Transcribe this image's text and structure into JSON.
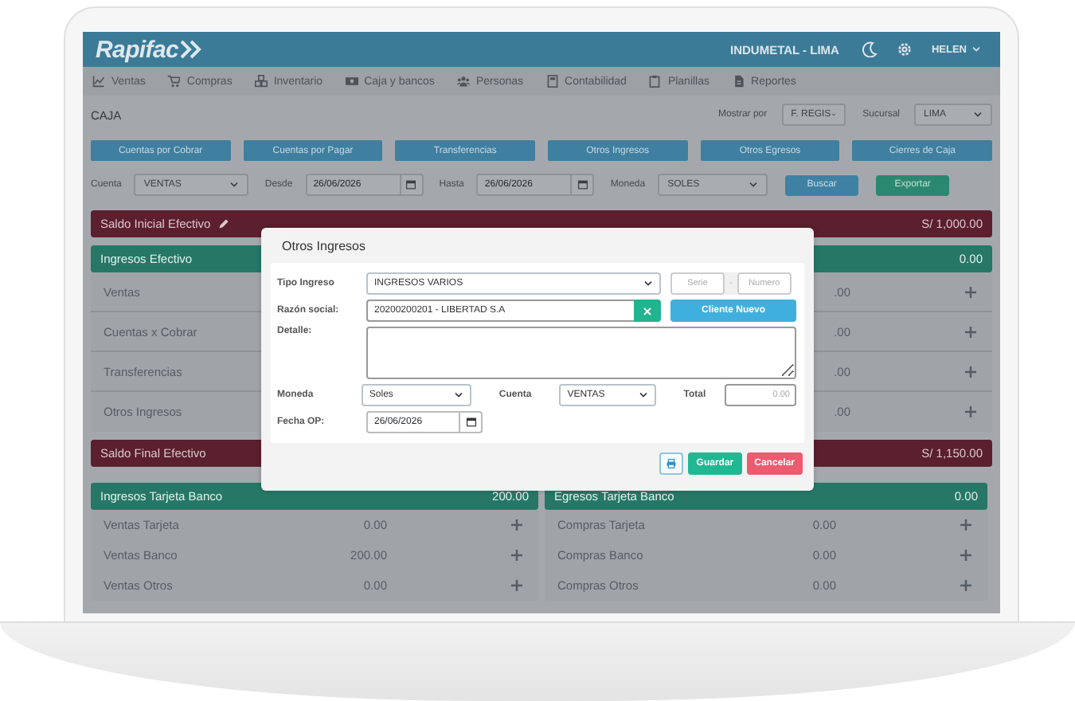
{
  "header": {
    "logo": "Rapifac",
    "company": "INDUMETAL - LIMA",
    "user": "HELEN"
  },
  "nav": [
    {
      "kind": "chart",
      "label": "Ventas"
    },
    {
      "kind": "cart",
      "label": "Compras"
    },
    {
      "kind": "boxes",
      "label": "Inventario"
    },
    {
      "kind": "cash",
      "label": "Caja y bancos"
    },
    {
      "kind": "people",
      "label": "Personas"
    },
    {
      "kind": "calc",
      "label": "Contabilidad"
    },
    {
      "kind": "clipboard",
      "label": "Planillas"
    },
    {
      "kind": "doc",
      "label": "Reportes"
    }
  ],
  "page": {
    "title": "CAJA",
    "show_by": {
      "label": "Mostrar por",
      "value": "F. REGIS"
    },
    "branch": {
      "label": "Sucursal",
      "value": "LIMA"
    }
  },
  "actions": [
    "Cuentas por Cobrar",
    "Cuentas por Pagar",
    "Transferencias",
    "Otros Ingresos",
    "Otros Egresos",
    "Cierres de Caja"
  ],
  "filters": [
    {
      "kind": "select",
      "label": "Cuenta",
      "value": "VENTAS"
    },
    {
      "kind": "date",
      "label": "Desde",
      "value": "26/06/2026"
    },
    {
      "kind": "date",
      "label": "Hasta",
      "value": "26/06/2026"
    },
    {
      "kind": "select",
      "label": "Moneda",
      "value": "SOLES"
    }
  ],
  "filter_buttons": [
    {
      "kind": "primary",
      "label": "Buscar"
    },
    {
      "kind": "success",
      "label": "Exportar"
    }
  ],
  "cash": {
    "opening": {
      "label": "Saldo Inicial Efectivo",
      "amount": "S/ 1,000.00"
    },
    "income": {
      "title": "Ingresos Efectivo",
      "total": "0.00",
      "rows": [
        {
          "label": "Ventas",
          "value": ".00"
        },
        {
          "label": "Cuentas x Cobrar",
          "value": ".00"
        },
        {
          "label": "Transferencias",
          "value": ".00"
        },
        {
          "label": "Otros Ingresos",
          "value": ".00"
        }
      ]
    },
    "closing": {
      "label": "Saldo Final Efectivo",
      "amount": "S/ 1,150.00"
    }
  },
  "bank": [
    {
      "title": "Ingresos Tarjeta Banco",
      "total": "200.00",
      "rows": [
        {
          "label": "Ventas Tarjeta",
          "value": "0.00"
        },
        {
          "label": "Ventas Banco",
          "value": "200.00"
        },
        {
          "label": "Ventas Otros",
          "value": "0.00"
        }
      ]
    },
    {
      "title": "Egresos Tarjeta Banco",
      "total": "0.00",
      "rows": [
        {
          "label": "Compras Tarjeta",
          "value": "0.00"
        },
        {
          "label": "Compras Banco",
          "value": "0.00"
        },
        {
          "label": "Compras Otros",
          "value": "0.00"
        }
      ]
    }
  ],
  "modal": {
    "title": "Otros Ingresos",
    "type": {
      "label": "Tipo Ingreso",
      "value": "INGRESOS VARIOS"
    },
    "series": {
      "placeholder": "Serie"
    },
    "separator": "-",
    "number": {
      "placeholder": "Numero"
    },
    "company": {
      "label": "Razón social:",
      "value": "20200200201 - LIBERTAD S.A"
    },
    "new_client": "Cliente Nuevo",
    "detail": {
      "label": "Detalle:"
    },
    "currency": {
      "label": "Moneda",
      "value": "Soles"
    },
    "account": {
      "label": "Cuenta",
      "value": "VENTAS"
    },
    "total": {
      "label": "Total",
      "placeholder": "0.00"
    },
    "date": {
      "label": "Fecha OP:",
      "value": "26/06/2026"
    },
    "buttons": [
      {
        "kind": "print"
      },
      {
        "kind": "save",
        "label": "Guardar"
      },
      {
        "kind": "cancel",
        "label": "Cancelar"
      }
    ]
  }
}
